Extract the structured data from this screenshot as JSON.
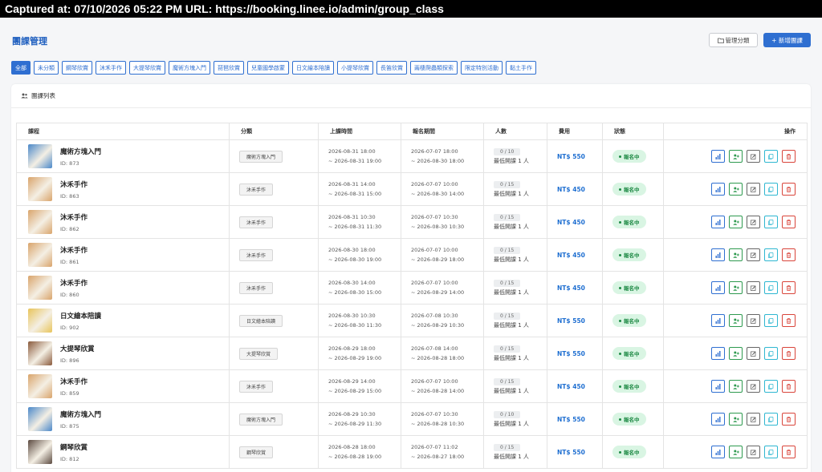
{
  "capture": {
    "text": "Captured at: 07/10/2026 05:22 PM    URL: https://booking.linee.io/admin/group_class"
  },
  "header": {
    "title": "團課管理",
    "manage_label": "管理分類",
    "add_label": "+ 新增團課"
  },
  "filters": [
    "全部",
    "未分類",
    "鋼琴欣賞",
    "沐禾手作",
    "大提琴欣賞",
    "魔術方塊入門",
    "琵琶欣賞",
    "兒童國學啟蒙",
    "日文繪本陪讀",
    "小提琴欣賞",
    "長笛欣賞",
    "兩棲爬蟲類探索",
    "限定特別活動",
    "黏土手作"
  ],
  "active_filter": "全部",
  "list": {
    "title": "團課列表"
  },
  "columns": [
    "課程",
    "分類",
    "上課時間",
    "報名期間",
    "人數",
    "費用",
    "狀態",
    "操作"
  ],
  "rows": [
    {
      "name": "魔術方塊入門",
      "id": "ID: 873",
      "category": "魔術方塊入門",
      "time_start": "2026-08-31 18:00",
      "time_end": "~ 2026-08-31 19:00",
      "reg_start": "2026-07-07 18:00",
      "reg_end": "~ 2026-08-30 18:00",
      "count": "0 / 10",
      "min": "最低開課 1 人",
      "fee": "NT$ 550",
      "status": "報名中",
      "thumb": "#4a88c9"
    },
    {
      "name": "沐禾手作",
      "id": "ID: 863",
      "category": "沐禾手作",
      "time_start": "2026-08-31 14:00",
      "time_end": "~ 2026-08-31 15:00",
      "reg_start": "2026-07-07 10:00",
      "reg_end": "~ 2026-08-30 14:00",
      "count": "0 / 15",
      "min": "最低開課 1 人",
      "fee": "NT$ 450",
      "status": "報名中",
      "thumb": "#d9a46b"
    },
    {
      "name": "沐禾手作",
      "id": "ID: 862",
      "category": "沐禾手作",
      "time_start": "2026-08-31 10:30",
      "time_end": "~ 2026-08-31 11:30",
      "reg_start": "2026-07-07 10:30",
      "reg_end": "~ 2026-08-30 10:30",
      "count": "0 / 15",
      "min": "最低開課 1 人",
      "fee": "NT$ 450",
      "status": "報名中",
      "thumb": "#d9a46b"
    },
    {
      "name": "沐禾手作",
      "id": "ID: 861",
      "category": "沐禾手作",
      "time_start": "2026-08-30 18:00",
      "time_end": "~ 2026-08-30 19:00",
      "reg_start": "2026-07-07 10:00",
      "reg_end": "~ 2026-08-29 18:00",
      "count": "0 / 15",
      "min": "最低開課 1 人",
      "fee": "NT$ 450",
      "status": "報名中",
      "thumb": "#d9a46b"
    },
    {
      "name": "沐禾手作",
      "id": "ID: 860",
      "category": "沐禾手作",
      "time_start": "2026-08-30 14:00",
      "time_end": "~ 2026-08-30 15:00",
      "reg_start": "2026-07-07 10:00",
      "reg_end": "~ 2026-08-29 14:00",
      "count": "0 / 15",
      "min": "最低開課 1 人",
      "fee": "NT$ 450",
      "status": "報名中",
      "thumb": "#d9a46b"
    },
    {
      "name": "日文繪本陪讀",
      "id": "ID: 902",
      "category": "日文繪本陪讀",
      "time_start": "2026-08-30 10:30",
      "time_end": "~ 2026-08-30 11:30",
      "reg_start": "2026-07-08 10:30",
      "reg_end": "~ 2026-08-29 10:30",
      "count": "0 / 15",
      "min": "最低開課 1 人",
      "fee": "NT$ 550",
      "status": "報名中",
      "thumb": "#e8c45a"
    },
    {
      "name": "大提琴欣賞",
      "id": "ID: 896",
      "category": "大提琴欣賞",
      "time_start": "2026-08-29 18:00",
      "time_end": "~ 2026-08-29 19:00",
      "reg_start": "2026-07-08 14:00",
      "reg_end": "~ 2026-08-28 18:00",
      "count": "0 / 15",
      "min": "最低開課 1 人",
      "fee": "NT$ 550",
      "status": "報名中",
      "thumb": "#8a5a3c"
    },
    {
      "name": "沐禾手作",
      "id": "ID: 859",
      "category": "沐禾手作",
      "time_start": "2026-08-29 14:00",
      "time_end": "~ 2026-08-29 15:00",
      "reg_start": "2026-07-07 10:00",
      "reg_end": "~ 2026-08-28 14:00",
      "count": "0 / 15",
      "min": "最低開課 1 人",
      "fee": "NT$ 450",
      "status": "報名中",
      "thumb": "#d9a46b"
    },
    {
      "name": "魔術方塊入門",
      "id": "ID: 875",
      "category": "魔術方塊入門",
      "time_start": "2026-08-29 10:30",
      "time_end": "~ 2026-08-29 11:30",
      "reg_start": "2026-07-07 10:30",
      "reg_end": "~ 2026-08-28 10:30",
      "count": "0 / 10",
      "min": "最低開課 1 人",
      "fee": "NT$ 550",
      "status": "報名中",
      "thumb": "#4a88c9"
    },
    {
      "name": "鋼琴欣賞",
      "id": "ID: 812",
      "category": "鋼琴欣賞",
      "time_start": "2026-08-28 18:00",
      "time_end": "~ 2026-08-28 19:00",
      "reg_start": "2026-07-07 11:02",
      "reg_end": "~ 2026-08-27 18:00",
      "count": "0 / 15",
      "min": "最低開課 1 人",
      "fee": "NT$ 550",
      "status": "報名中",
      "thumb": "#5b4a40"
    }
  ],
  "colors": {
    "primary": "#2f6fd1",
    "status_bg": "#d9f5e3",
    "status_text": "#1e8a45"
  },
  "action_icons": [
    "stats-icon",
    "add-member-icon",
    "edit-icon",
    "copy-icon",
    "delete-icon"
  ]
}
